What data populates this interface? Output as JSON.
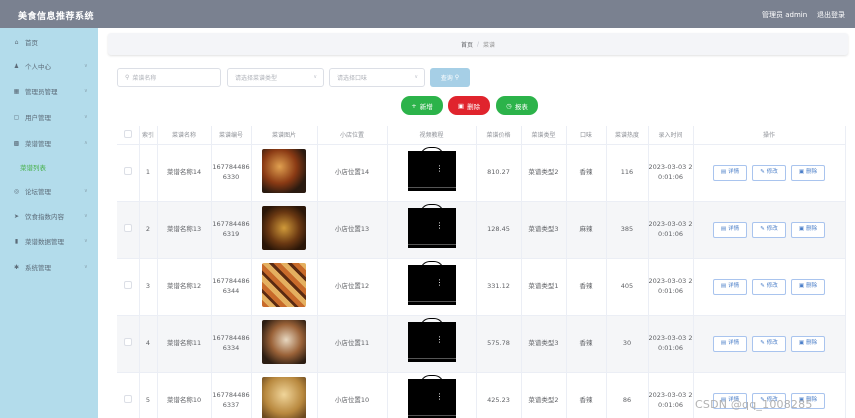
{
  "header": {
    "title": "美食信息推荐系统",
    "user": "管理员 admin",
    "logout": "退出登录"
  },
  "sidebar": {
    "items": [
      {
        "label": "首页",
        "icon": "home-icon",
        "glyph": "⌂"
      },
      {
        "label": "个人中心",
        "icon": "user-icon",
        "glyph": "♟"
      },
      {
        "label": "管理员管理",
        "icon": "admin-icon",
        "glyph": "▦"
      },
      {
        "label": "用户管理",
        "icon": "users-icon",
        "glyph": "▢"
      },
      {
        "label": "菜谱管理",
        "icon": "grid-icon",
        "glyph": "▩"
      },
      {
        "label": "论坛管理",
        "icon": "forum-icon",
        "glyph": "◎"
      },
      {
        "label": "饮食指数内容",
        "icon": "send-icon",
        "glyph": "➤"
      },
      {
        "label": "菜谱数据管理",
        "icon": "chart-icon",
        "glyph": "▮"
      },
      {
        "label": "系统管理",
        "icon": "settings-icon",
        "glyph": "✱"
      }
    ],
    "active_sub": "菜谱列表"
  },
  "breadcrumb": {
    "home": "首页",
    "sep": "/",
    "current": "菜谱"
  },
  "filters": {
    "name_placeholder": "菜谱名称",
    "type_placeholder": "请选择菜谱类型",
    "taste_placeholder": "请选择口味",
    "query": "查询"
  },
  "actions": {
    "add": "新增",
    "delete": "删除",
    "report": "报表"
  },
  "table": {
    "headers": [
      "索引",
      "菜谱名称",
      "菜谱编号",
      "菜谱图片",
      "小店位置",
      "视频教程",
      "菜谱价格",
      "菜谱类型",
      "口味",
      "菜谱热度",
      "录入时间",
      "操作"
    ],
    "op_labels": {
      "detail": "详情",
      "edit": "修改",
      "delete": "删除"
    },
    "rows": [
      {
        "idx": "1",
        "name": "菜谱名称14",
        "code": "1677844866330",
        "loc": "小店位置14",
        "price": "810.27",
        "type": "菜谱类型2",
        "taste": "香辣",
        "heat": "116",
        "time": "2023-03-03 20:01:06"
      },
      {
        "idx": "2",
        "name": "菜谱名称13",
        "code": "1677844866319",
        "loc": "小店位置13",
        "price": "128.45",
        "type": "菜谱类型3",
        "taste": "麻辣",
        "heat": "385",
        "time": "2023-03-03 20:01:06"
      },
      {
        "idx": "3",
        "name": "菜谱名称12",
        "code": "1677844866344",
        "loc": "小店位置12",
        "price": "331.12",
        "type": "菜谱类型1",
        "taste": "香辣",
        "heat": "405",
        "time": "2023-03-03 20:01:06"
      },
      {
        "idx": "4",
        "name": "菜谱名称11",
        "code": "1677844866334",
        "loc": "小店位置11",
        "price": "575.78",
        "type": "菜谱类型3",
        "taste": "香辣",
        "heat": "30",
        "time": "2023-03-03 20:01:06"
      },
      {
        "idx": "5",
        "name": "菜谱名称10",
        "code": "1677844866337",
        "loc": "小店位置10",
        "price": "425.23",
        "type": "菜谱类型2",
        "taste": "香辣",
        "heat": "86",
        "time": "2023-03-03 20:01:06"
      }
    ]
  },
  "watermark": "CSDN @qq_1008285",
  "colors": {
    "topbar": "#7a8190",
    "sidebar": "#b3dceb",
    "add": "#2cb34a",
    "delete": "#e0242d",
    "report": "#2cb34a",
    "link": "#4a7ec8"
  }
}
